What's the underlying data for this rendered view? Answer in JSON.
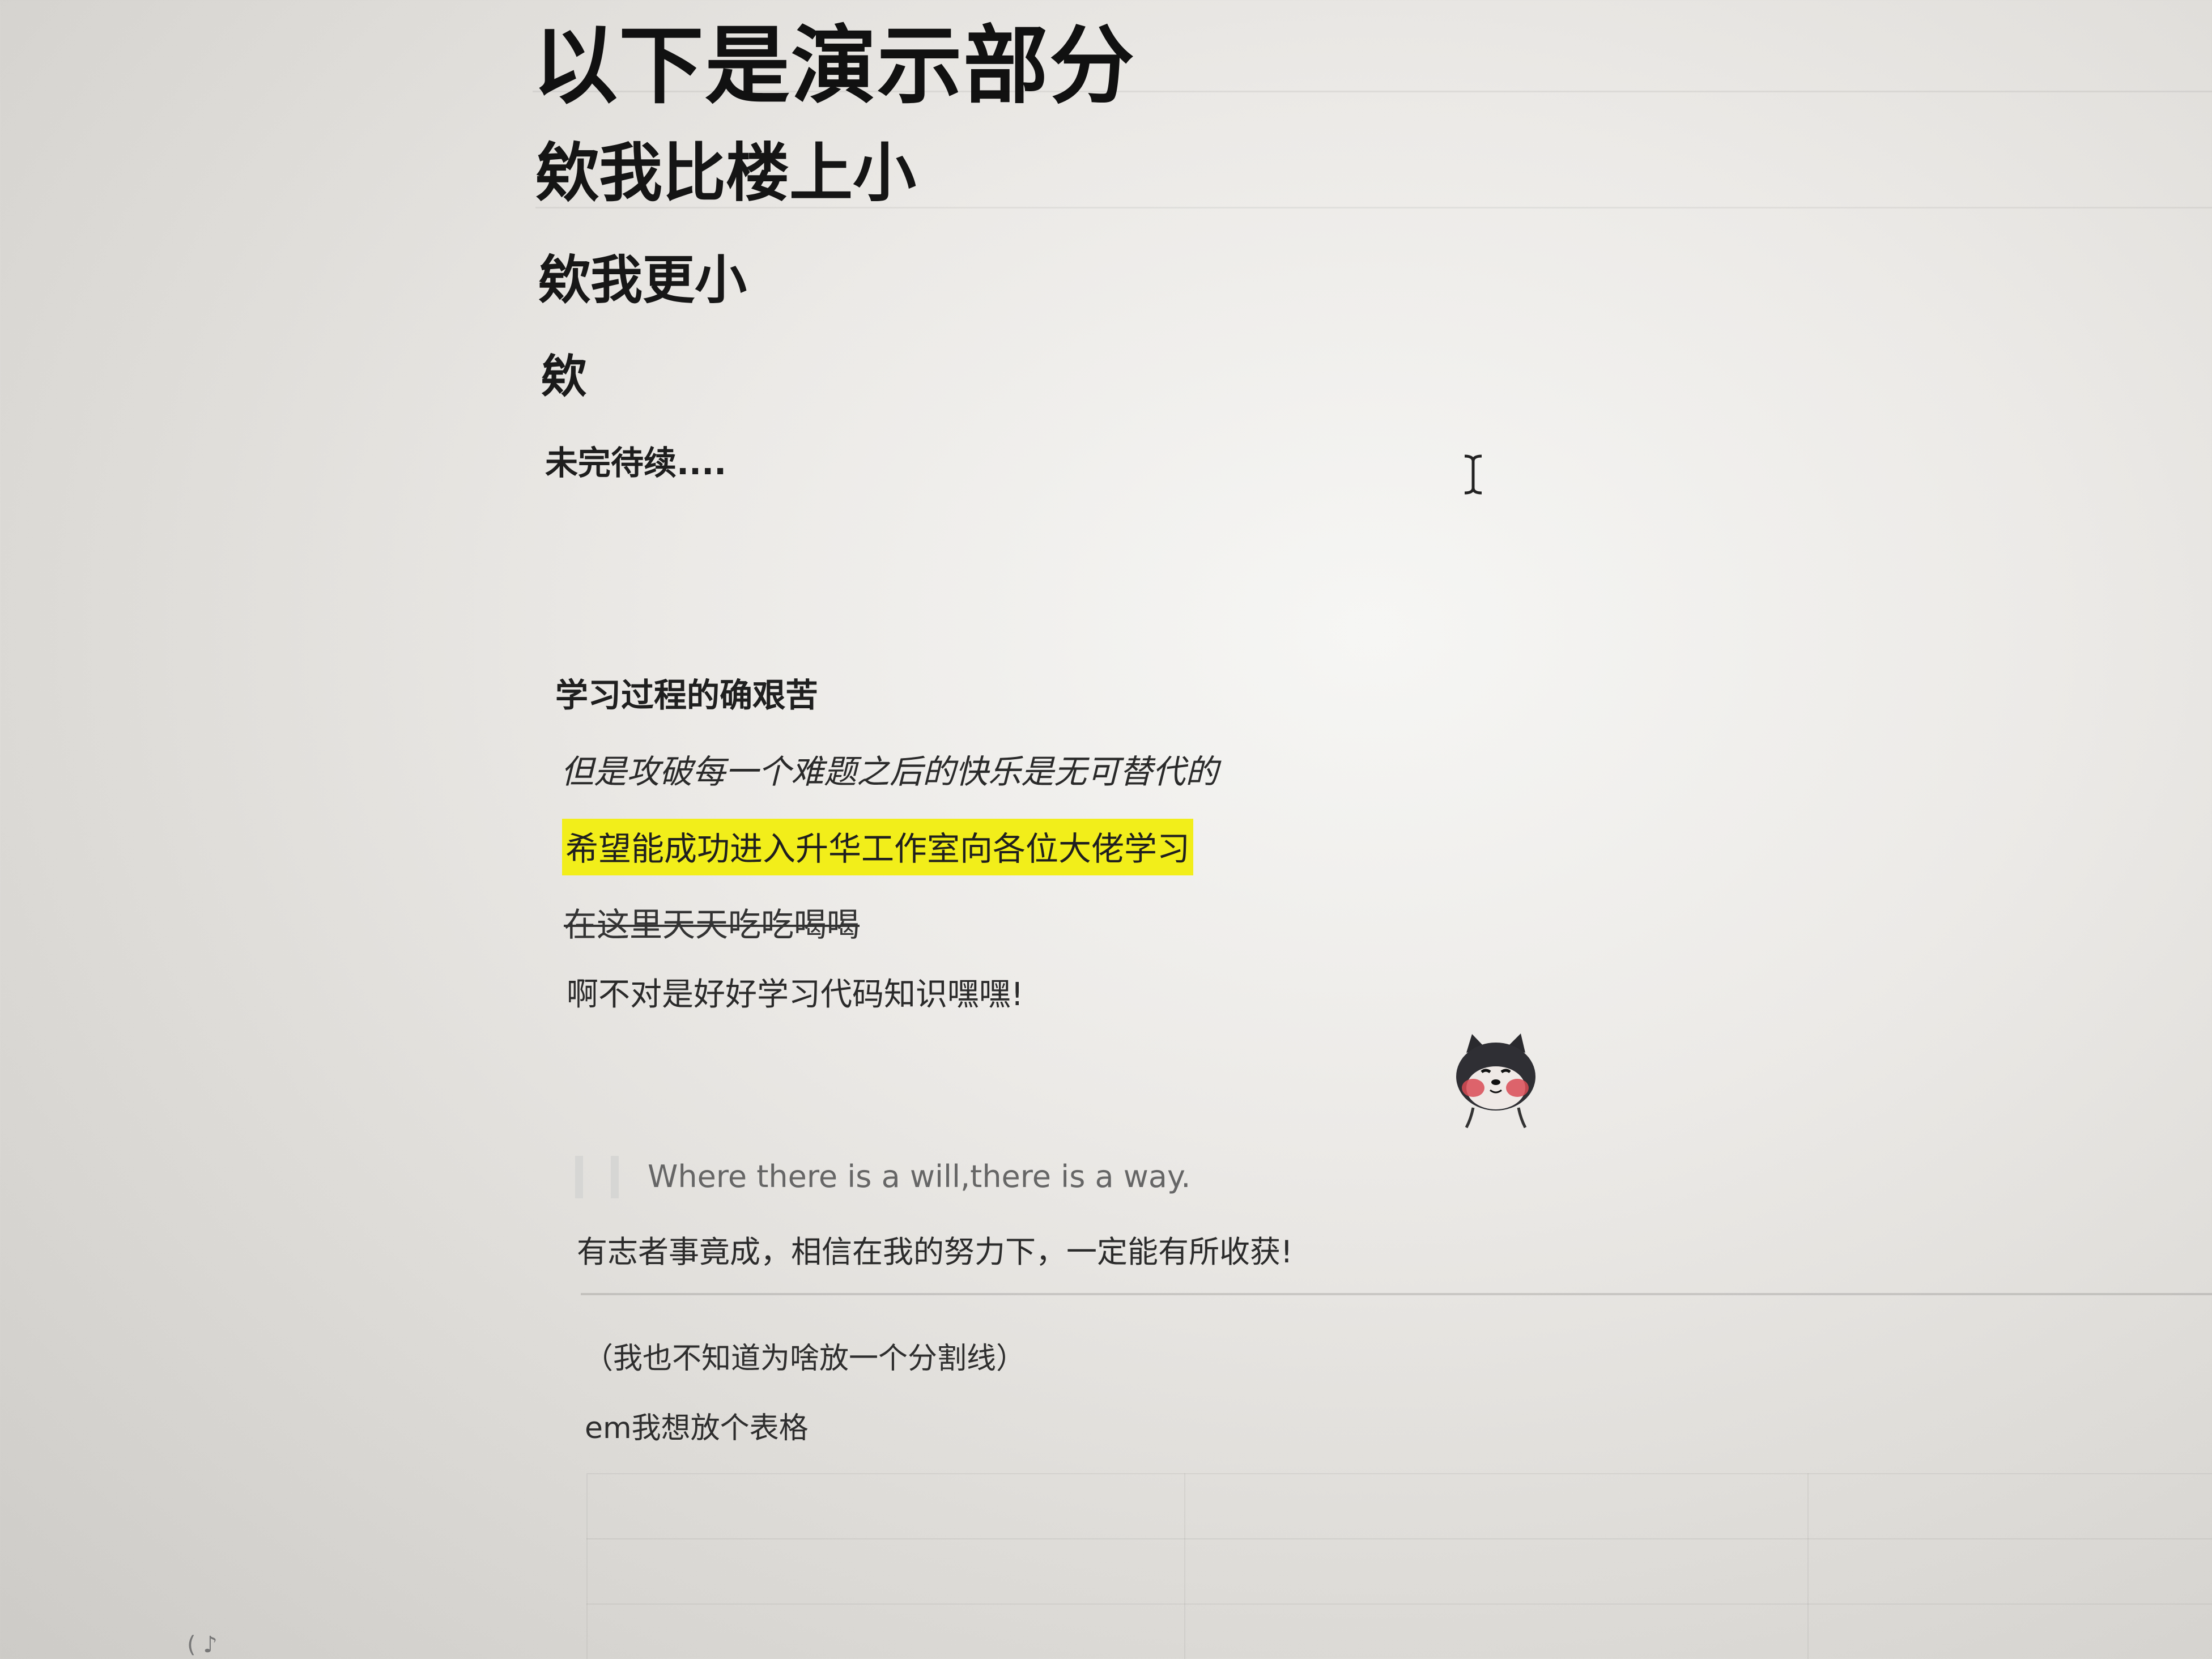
{
  "document": {
    "heading1": "以下是演示部分",
    "heading2": "欸我比楼上小",
    "heading3": "欸我更小",
    "heading4": "欸",
    "heading5": "未完待续....",
    "strong_paragraph": "学习过程的确艰苦",
    "italic_paragraph": "但是攻破每一个难题之后的快乐是无可替代的",
    "highlight_paragraph": "希望能成功进入升华工作室向各位大佬学习",
    "strikethrough_paragraph": "在这里天天吃吃喝喝",
    "normal_paragraph": "啊不对是好好学习代码知识嘿嘿!",
    "blockquote": "Where there is a will,there is a way.",
    "quote_translation": "有志者事竟成，相信在我的努力下，一定能有所收获!",
    "divider_note": "（我也不知道为啥放一个分割线）",
    "table_intro": "em我想放个表格",
    "bottom_corner": "( ♪"
  },
  "colors": {
    "highlight": "#f2ee1a",
    "quote_bar": "#d6d6d4",
    "text": "#1c1c1c"
  },
  "icons": {
    "cursor": "text-cursor-icon",
    "sticker": "shiba-dog-sticker"
  }
}
